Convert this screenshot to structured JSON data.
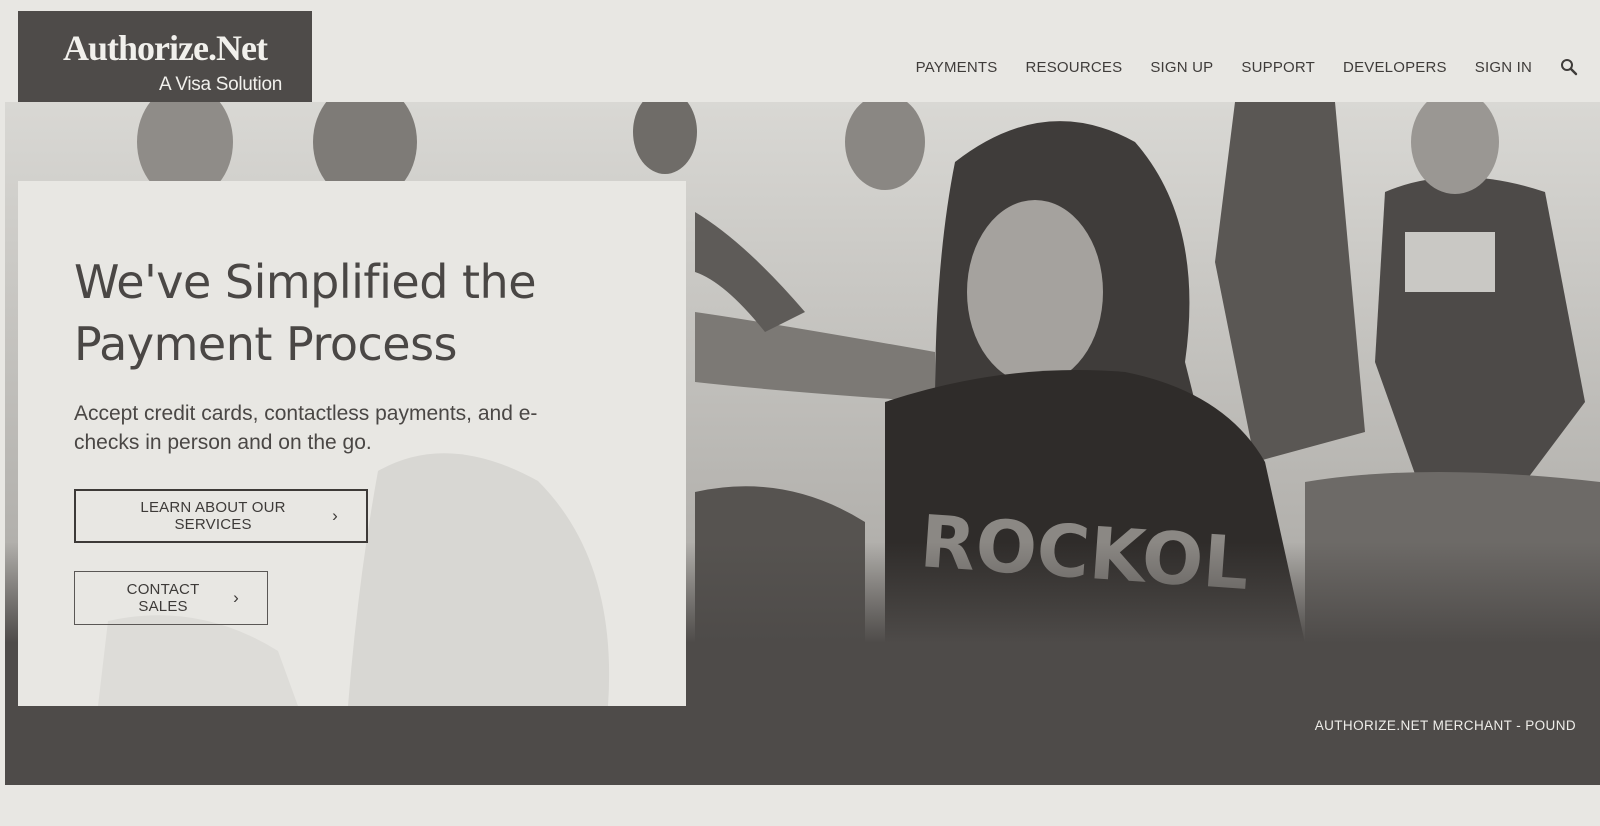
{
  "header": {
    "logo_brand": "Authorize.Net",
    "logo_tagline": "A Visa Solution",
    "nav": [
      "PAYMENTS",
      "RESOURCES",
      "SIGN UP",
      "SUPPORT",
      "DEVELOPERS",
      "SIGN IN"
    ],
    "search_icon": "search-icon"
  },
  "hero": {
    "title": "We've Simplified the Payment Process",
    "subtitle": "Accept credit cards, contactless payments, and e-checks in person and on the go.",
    "primary_cta": "LEARN ABOUT OUR SERVICES",
    "secondary_cta": "CONTACT SALES",
    "chevron_icon": "chevron-right-icon",
    "shirt_text": "ROCKOL",
    "merchant_caption": "AUTHORIZE.NET MERCHANT - POUND"
  },
  "colors": {
    "background": "#e8e7e3",
    "dark": "#4e4b49",
    "text": "#4a4745"
  }
}
